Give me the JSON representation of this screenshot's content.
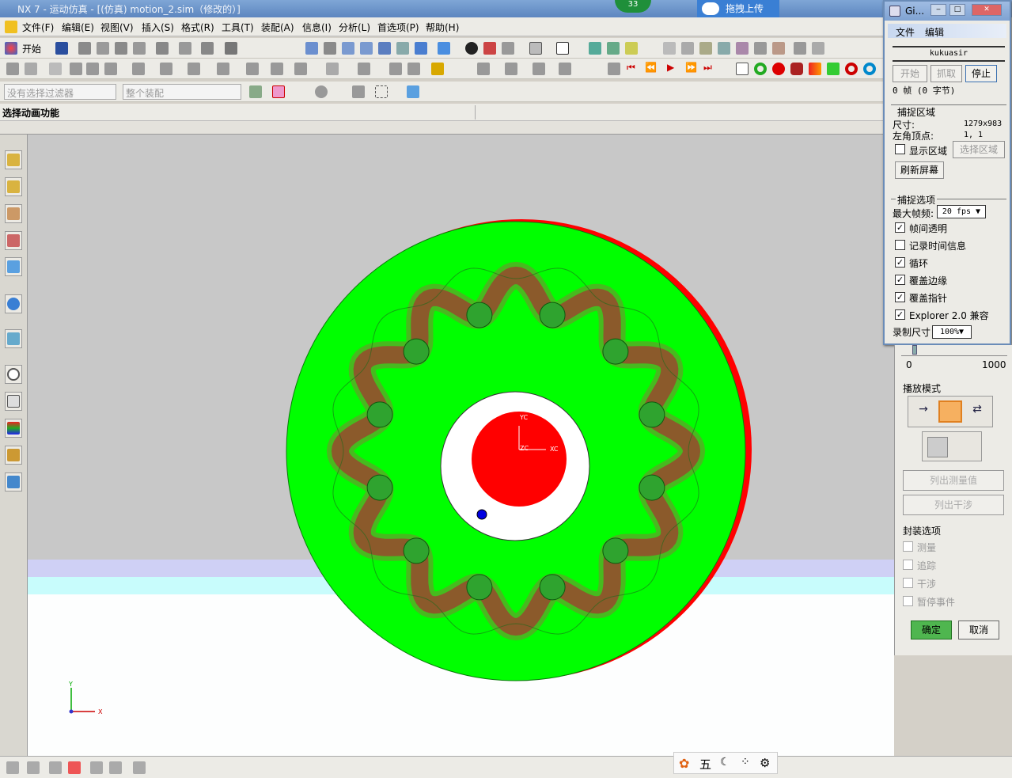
{
  "window": {
    "title": "NX 7 - 运动仿真 - [(仿真) motion_2.sim（修改的）]",
    "badge": "33",
    "upload": "拖拽上传"
  },
  "menubar": {
    "items": [
      "文件(F)",
      "编辑(E)",
      "视图(V)",
      "插入(S)",
      "格式(R)",
      "工具(T)",
      "装配(A)",
      "信息(I)",
      "分析(L)",
      "首选项(P)",
      "帮助(H)"
    ]
  },
  "toolbar": {
    "start_label": "开始"
  },
  "filters": {
    "selection": "没有选择过滤器",
    "scope": "整个装配"
  },
  "cue": {
    "text": "选择动画功能"
  },
  "viewport": {
    "triad_y": "Y",
    "triad_x": "X",
    "wcs_yc": "YC",
    "wcs_xc": "XC",
    "wcs_zc": "ZC",
    "colors": {
      "disk": "#00ff00",
      "rim": "#ff0000",
      "hub": "#ff0000",
      "chain": "#8b5a2b",
      "ball": "#2fa32f",
      "bg": "#c8c8c8"
    }
  },
  "gif_recorder": {
    "title": "Gi...",
    "menu": [
      "文件",
      "编辑"
    ],
    "name": "kukuasir",
    "buttons": {
      "start": "开始",
      "grab": "抓取",
      "stop": "停止"
    },
    "frames": "0 帧 (0 字节)",
    "capture_section": "捕捉区域",
    "size_label": "尺寸:",
    "size_value": "1279x983",
    "corner_label": "左角顶点:",
    "corner_value": "1, 1",
    "show_area": "显示区域",
    "select_area": "选择区域",
    "refresh": "刷新屏幕",
    "options_section": "捕捉选项",
    "max_fps_label": "最大帧频:",
    "max_fps_value": "20 fps",
    "checks": [
      {
        "label": "帧间透明",
        "checked": true
      },
      {
        "label": "记录时间信息",
        "checked": false
      },
      {
        "label": "循环",
        "checked": true
      },
      {
        "label": "覆盖边缘",
        "checked": true
      },
      {
        "label": "覆盖指针",
        "checked": true
      },
      {
        "label": "Explorer 2.0 兼容",
        "checked": true
      }
    ],
    "rec_size_label": "录制尺寸",
    "rec_size_value": "100%"
  },
  "motion_panel": {
    "slider_min": "0",
    "slider_max": "1000",
    "play_mode": "播放模式",
    "list_measure": "列出测量值",
    "list_interference": "列出干涉",
    "package_options": "封装选项",
    "package_items": [
      "测量",
      "追踪",
      "干涉",
      "暂停事件"
    ],
    "ok": "确定",
    "cancel": "取消"
  },
  "tray": {
    "label": "五"
  }
}
